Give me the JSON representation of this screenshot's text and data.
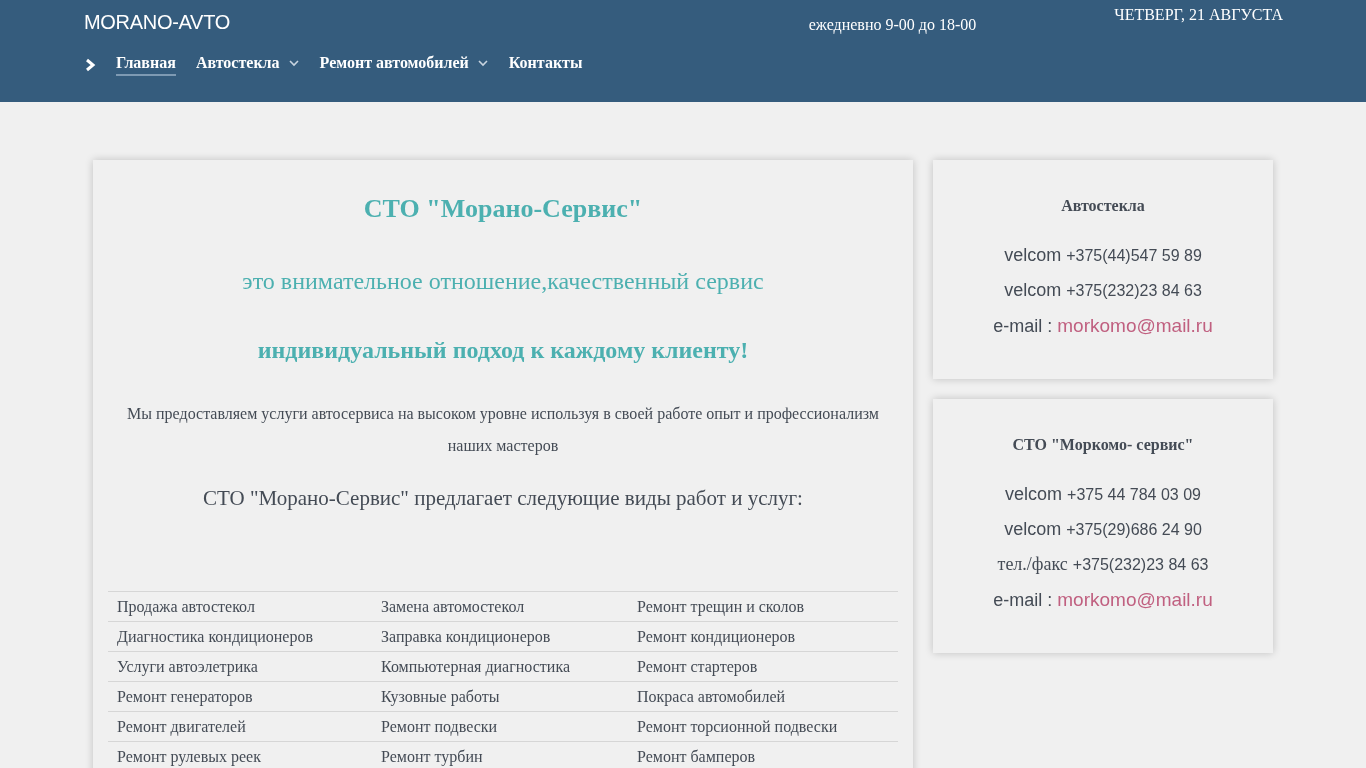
{
  "header": {
    "logo": "MORANO-AVTO",
    "hours": "ежедневно 9-00 до 18-00",
    "date": "ЧЕТВЕРГ, 21 АВГУСТА"
  },
  "nav": [
    {
      "label": "Главная",
      "selected": true,
      "dropdown": false
    },
    {
      "label": "Автостекла",
      "selected": false,
      "dropdown": true
    },
    {
      "label": "Ремонт автомобилей",
      "selected": false,
      "dropdown": true
    },
    {
      "label": "Контакты",
      "selected": false,
      "dropdown": false
    }
  ],
  "main": {
    "title": "СТО \"Морано-Сервис\"",
    "subtitle": "это внимательное отношение,качественный сервис",
    "tagline": "индивидуальный подход к каждому клиенту!",
    "intro": "Мы предоставляем услуги автосервиса на высоком уровне используя в своей работе опыт и профессионализм наших мастеров",
    "services_heading": "СТО \"Морано-Сервис\" предлагает следующие виды работ и услуг:",
    "services": [
      [
        "Продажа автостекол",
        "Замена автомостекол",
        "Ремонт трещин и сколов"
      ],
      [
        "Диагностика кондиционеров",
        "Заправка кондиционеров",
        "Ремонт кондиционеров"
      ],
      [
        "Услуги автоэлетрика",
        "Компьютерная диагностика",
        "Ремонт стартеров"
      ],
      [
        "Ремонт генераторов",
        "Кузовные работы",
        "Покраса автомобилей"
      ],
      [
        "Ремонт двигателей",
        "Ремонт подвески",
        "Ремонт торсионной подвески"
      ],
      [
        "Ремонт рулевых реек",
        "Ремонт турбин",
        "Ремонт бамперов"
      ]
    ]
  },
  "sidebar": [
    {
      "title": "Автостекла",
      "contacts": [
        {
          "kind": "phone",
          "label": "velcom",
          "value": "+375(44)547 59 89"
        },
        {
          "kind": "phone",
          "label": "velcom",
          "value": "+375(232)23 84 63"
        },
        {
          "kind": "email",
          "label": "e-mail :",
          "value": "morkomo@mail.ru"
        }
      ]
    },
    {
      "title": "СТО \"Моркомо- сервис\"",
      "contacts": [
        {
          "kind": "phone",
          "label": "velcom",
          "value": "+375 44 784 03 09"
        },
        {
          "kind": "phone",
          "label": "velcom",
          "value": "+375(29)686 24 90"
        },
        {
          "kind": "fax",
          "label": "тел./факс",
          "value": "+375(232)23 84 63"
        },
        {
          "kind": "email",
          "label": "e-mail :",
          "value": "morkomo@mail.ru"
        }
      ]
    }
  ]
}
